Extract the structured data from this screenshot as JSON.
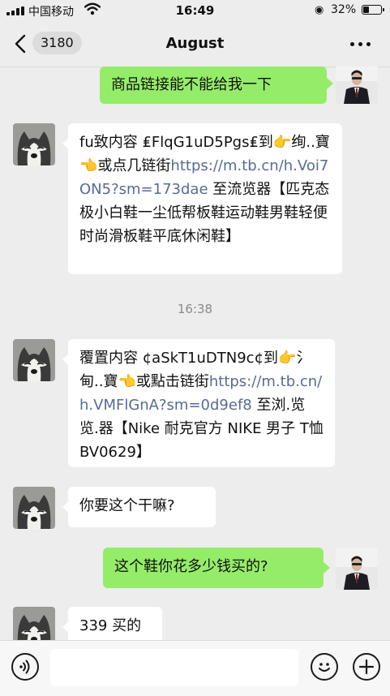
{
  "status_bar": {
    "carrier": "中国移动",
    "time": "16:49",
    "battery_percent": "32%",
    "battery_level": 0.32,
    "icons": [
      "signal-icon",
      "wifi-icon",
      "orientation-lock-icon",
      "battery-icon"
    ]
  },
  "nav": {
    "unread_count": "3180",
    "title": "August",
    "icons": [
      "back-chevron-icon",
      "more-dots-icon"
    ]
  },
  "messages": [
    {
      "side": "right",
      "avatar": "man-in-suit-avatar",
      "parts": [
        {
          "text": "商品链接能不能给我一下"
        }
      ]
    },
    {
      "side": "left",
      "avatar": "husky-avatar",
      "parts": [
        {
          "text": "fu致内容 ₤FlqG1uD5Pgs₤到👉绚..寶👈或点几链街"
        },
        {
          "text": "https://m.tb.cn/h.Voi7ON5?sm=173dae",
          "link": true
        },
        {
          "text": " 至流览器【匹克态极小白鞋一尘低帮板鞋运动鞋男鞋轻便时尚滑板鞋平底休闲鞋】"
        }
      ]
    },
    {
      "timestamp": "16:38"
    },
    {
      "side": "left",
      "avatar": "husky-avatar",
      "parts": [
        {
          "text": "覆置内容 ¢aSkT1uDTN9c¢到👉氵 甸..寶👈或點击链街"
        },
        {
          "text": "https://m.tb.cn/h.VMFlGnA?sm=0d9ef8",
          "link": true
        },
        {
          "text": " 至浏.览览.器【Nike 耐克官方 NIKE 男子 T恤 BV0629】"
        }
      ]
    },
    {
      "side": "left",
      "avatar": "husky-avatar",
      "parts": [
        {
          "text": "你要这个干嘛?"
        }
      ]
    },
    {
      "side": "right",
      "avatar": "man-in-suit-avatar",
      "parts": [
        {
          "text": "这个鞋你花多少钱买的?"
        }
      ]
    },
    {
      "side": "left",
      "avatar": "husky-avatar",
      "parts": [
        {
          "text": "339 买的"
        }
      ]
    }
  ],
  "input_bar": {
    "text_value": "",
    "icons": [
      "voice-icon",
      "emoji-icon",
      "plus-icon"
    ]
  },
  "colors": {
    "background": "#EDEDED",
    "sent_bubble": "#95EC69",
    "received_bubble": "#FFFFFF",
    "link": "#576B95"
  }
}
